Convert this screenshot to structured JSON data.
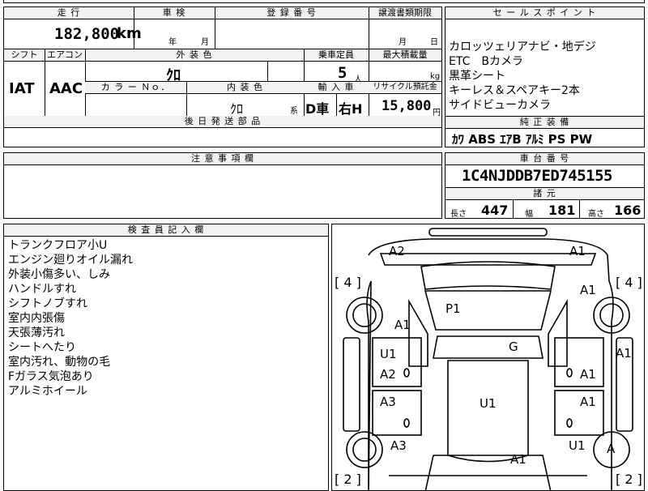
{
  "top_partial": "",
  "mileage": {
    "header": "走 行",
    "value": "182,800",
    "unit": "km"
  },
  "shaken": {
    "header": "車 検",
    "year_unit": "年",
    "month_unit": "月"
  },
  "registration": {
    "header": "登 録 番 号",
    "value": ""
  },
  "transfer": {
    "header": "譲渡書類期限",
    "month_unit": "月",
    "day_unit": "日"
  },
  "shift": {
    "header": "シフト",
    "value": "IAT"
  },
  "aircon": {
    "header": "エアコン",
    "value": "AAC"
  },
  "exterior_color": {
    "header": "外 装 色",
    "value": "ｸﾛ"
  },
  "capacity": {
    "header": "乗車定員",
    "value": "5",
    "unit": "人"
  },
  "max_load": {
    "header": "最大積載量",
    "unit": "kg"
  },
  "color_no": {
    "header": "カ ラ ー Ｎｏ．",
    "value": ""
  },
  "interior_color": {
    "header": "内 装 色",
    "value": "ｸﾛ",
    "suffix": "系"
  },
  "import": {
    "header": "輸 入 車",
    "dealer": "D車",
    "handle": "右H"
  },
  "recycle": {
    "header": "リサイクル預託金",
    "value": "15,800",
    "unit": "円"
  },
  "later_parts": {
    "header": "後 日 発 送 部 品"
  },
  "sales_points": {
    "header": "セ ー ル ス ポ イ ン ト",
    "items": [
      "カロッツェリアナビ・地デジ",
      "ETC　Bカメラ",
      "黒革シート",
      "キーレス＆スペアキー2本",
      "サイドビューカメラ"
    ]
  },
  "standard_equipment": {
    "header": "純 正 装 備",
    "value": "ｶﾜ ABS ｴｱB ｱﾙﾐ PS PW"
  },
  "notes": {
    "header": "注 意 事 項 欄"
  },
  "chassis": {
    "header": "車 台 番 号",
    "value": "1C4NJDDB7ED745155"
  },
  "dimensions": {
    "header": "諸 元",
    "length_label": "長さ",
    "length": "447",
    "width_label": "幅",
    "width": "181",
    "height_label": "高さ",
    "height": "166"
  },
  "inspector": {
    "header": "検 査 員 記 入 欄",
    "items": [
      "トランクフロア小U",
      "エンジン廻りオイル漏れ",
      "外装小傷多い、しみ",
      "ハンドルすれ",
      "シフトノブすれ",
      "室内内張傷",
      "天張薄汚れ",
      "シートへたり",
      "室内汚れ、動物の毛",
      "Fガラス気泡あり",
      "アルミホイール"
    ]
  },
  "diagram": {
    "tires": {
      "front_left": "4",
      "front_right": "4",
      "rear_left": "2",
      "rear_right": "2"
    },
    "marks": {
      "a2_top": "A2",
      "a1_top_right": "A1",
      "a1_right_upper": "A1",
      "p1": "P1",
      "a1_left_upper": "A1",
      "a1_right_side": "A1",
      "g": "G",
      "u1_left": "U1",
      "a2_left": "A2",
      "a1_right_mid": "A1",
      "a3_left": "A3",
      "u1_center": "U1",
      "a1_right_lower": "A1",
      "a3_left_lower": "A3",
      "u1_right": "U1",
      "a_circle": "A",
      "a1_bottom": "A1"
    }
  }
}
